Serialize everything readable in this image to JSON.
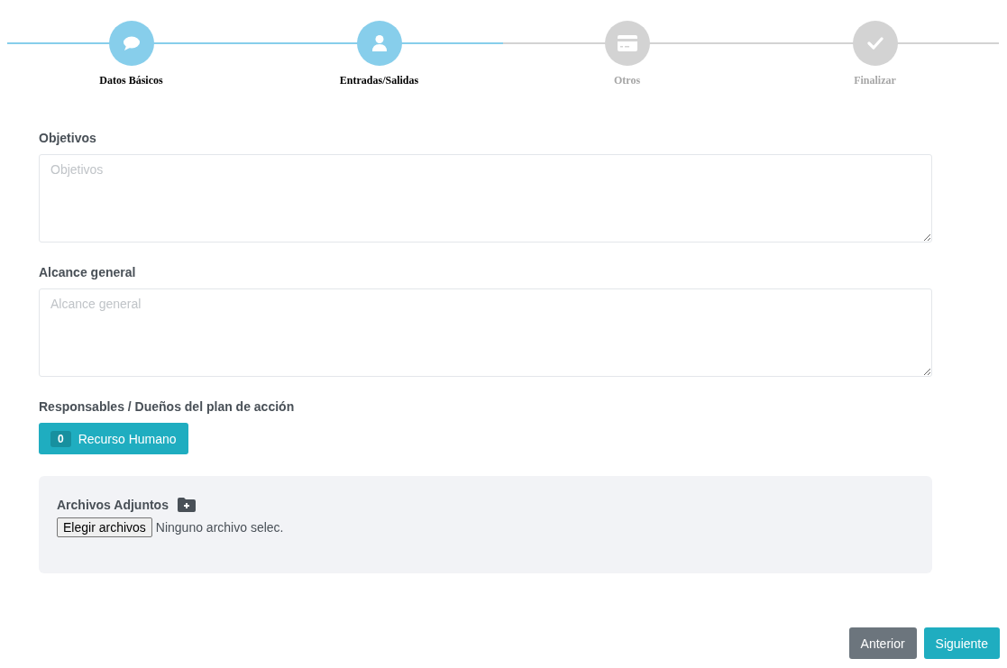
{
  "steps": [
    {
      "label": "Datos Básicos",
      "kind": "chat",
      "active": true
    },
    {
      "label": "Entradas/Salidas",
      "kind": "user",
      "active": true
    },
    {
      "label": "Otros",
      "kind": "card",
      "active": false
    },
    {
      "label": "Finalizar",
      "kind": "check",
      "active": false
    }
  ],
  "fields": [
    {
      "label": "Objetivos",
      "placeholder": "Objetivos"
    },
    {
      "label": "Alcance general",
      "placeholder": "Alcance general"
    }
  ],
  "owners": {
    "label": "Responsables / Dueños del plan de acción",
    "count": "0",
    "button": "Recurso Humano"
  },
  "attachments": {
    "title": "Archivos Adjuntos",
    "choose": "Elegir archivos",
    "status": "Ninguno archivo selec."
  },
  "nav": {
    "previous": "Anterior",
    "next": "Siguiente"
  }
}
